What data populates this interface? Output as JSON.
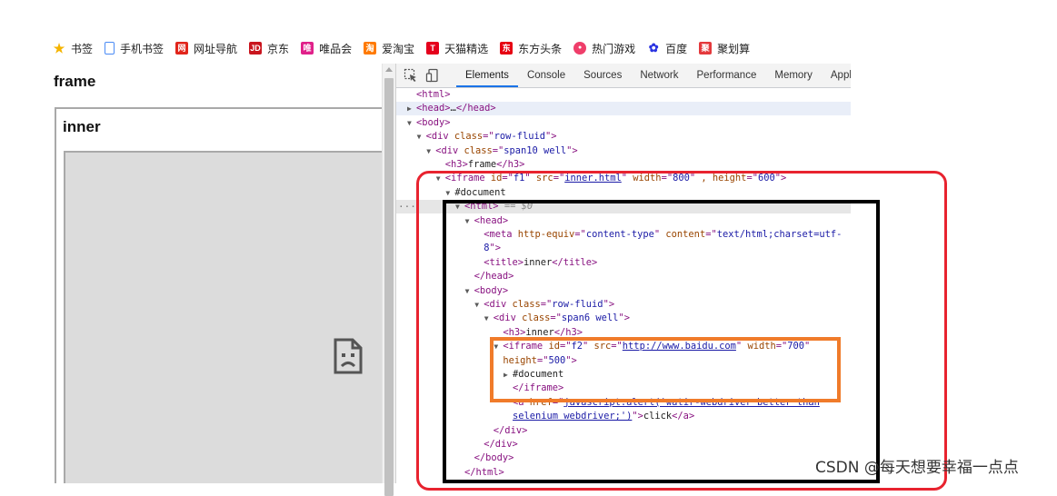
{
  "bookmarks": [
    {
      "label": "书签",
      "icon": "star-icon",
      "color": "#f5b400",
      "glyph": "★"
    },
    {
      "label": "手机书签",
      "icon": "phone-bookmark-icon",
      "color": "#4a8bf5",
      "glyph": ""
    },
    {
      "label": "网址导航",
      "icon": "nav-icon",
      "color": "#e1251b",
      "glyph": "网"
    },
    {
      "label": "京东",
      "icon": "jd-icon",
      "color": "#c9151e",
      "glyph": "JD"
    },
    {
      "label": "唯品会",
      "icon": "vip-icon",
      "color": "#e0218a",
      "glyph": "唯"
    },
    {
      "label": "爱淘宝",
      "icon": "taobao-icon",
      "color": "#ff7a00",
      "glyph": "淘"
    },
    {
      "label": "天猫精选",
      "icon": "tmall-icon",
      "color": "#e5001c",
      "glyph": "T"
    },
    {
      "label": "东方头条",
      "icon": "toutiao-icon",
      "color": "#e60012",
      "glyph": "东"
    },
    {
      "label": "热门游戏",
      "icon": "game-icon",
      "color": "#ef3e6a",
      "glyph": "●"
    },
    {
      "label": "百度",
      "icon": "baidu-icon",
      "color": "#2932e1",
      "glyph": "✿"
    },
    {
      "label": "聚划算",
      "icon": "juhuasuan-icon",
      "color": "#e4393c",
      "glyph": "聚"
    }
  ],
  "page": {
    "frame_heading": "frame",
    "inner_heading": "inner"
  },
  "devtools": {
    "tabs": [
      "Elements",
      "Console",
      "Sources",
      "Network",
      "Performance",
      "Memory",
      "Appl"
    ],
    "active_tab": "Elements",
    "dom_lines": [
      {
        "indent": 0,
        "tri": "",
        "html": "<span class=\"tag\">&lt;html&gt;</span>"
      },
      {
        "indent": 0,
        "tri": "▶",
        "cls": "sel-head",
        "html": "<span class=\"tag\">&lt;head&gt;</span><span class=\"txt\">…</span><span class=\"tag\">&lt;/head&gt;</span>"
      },
      {
        "indent": 0,
        "tri": "▼",
        "html": "<span class=\"tag\">&lt;body&gt;</span>"
      },
      {
        "indent": 1,
        "tri": "▼",
        "html": "<span class=\"tag\">&lt;div </span><span class=\"an\">class</span><span class=\"tag\">=\"</span><span class=\"av\">row-fluid</span><span class=\"tag\">\"&gt;</span>"
      },
      {
        "indent": 2,
        "tri": "▼",
        "html": "<span class=\"tag\">&lt;div </span><span class=\"an\">class</span><span class=\"tag\">=\"</span><span class=\"av\">span10 well</span><span class=\"tag\">\"&gt;</span>"
      },
      {
        "indent": 3,
        "tri": "",
        "html": "<span class=\"tag\">&lt;h3&gt;</span><span class=\"txt\">frame</span><span class=\"tag\">&lt;/h3&gt;</span>"
      },
      {
        "indent": 3,
        "tri": "▼",
        "html": "<span class=\"tag\">&lt;iframe </span><span class=\"an\">id</span><span class=\"tag\">=\"</span><span class=\"av\">f1</span><span class=\"tag\">\" </span><span class=\"an\">src</span><span class=\"tag\">=\"</span><span class=\"av link\">inner.html</span><span class=\"tag\">\" </span><span class=\"an\">width</span><span class=\"tag\">=\"</span><span class=\"av\">800</span><span class=\"tag\">\" </span><span class=\"an\">,</span> <span class=\"an\">height</span><span class=\"tag\">=\"</span><span class=\"av\">600</span><span class=\"tag\">\"&gt;</span>"
      },
      {
        "indent": 4,
        "tri": "▼",
        "html": "<span class=\"txt\">#document</span>"
      },
      {
        "indent": 5,
        "tri": "▼",
        "cls": "current",
        "dots": "···",
        "html": "<span class=\"tag\">&lt;html&gt;</span> <span class=\"muted\">== $0</span>"
      },
      {
        "indent": 6,
        "tri": "▼",
        "html": "<span class=\"tag\">&lt;head&gt;</span>"
      },
      {
        "indent": 7,
        "tri": "",
        "html": "<span class=\"tag\">&lt;meta </span><span class=\"an\">http-equiv</span><span class=\"tag\">=\"</span><span class=\"av\">content-type</span><span class=\"tag\">\" </span><span class=\"an\">content</span><span class=\"tag\">=\"</span><span class=\"av\">text/html;charset=utf-</span>"
      },
      {
        "indent": 7,
        "tri": "",
        "html": "<span class=\"av\">8</span><span class=\"tag\">\"&gt;</span>"
      },
      {
        "indent": 7,
        "tri": "",
        "html": "<span class=\"tag\">&lt;title&gt;</span><span class=\"txt\">inner</span><span class=\"tag\">&lt;/title&gt;</span>"
      },
      {
        "indent": 6,
        "tri": "",
        "html": "<span class=\"tag\">&lt;/head&gt;</span>"
      },
      {
        "indent": 6,
        "tri": "▼",
        "html": "<span class=\"tag\">&lt;body&gt;</span>"
      },
      {
        "indent": 7,
        "tri": "▼",
        "html": "<span class=\"tag\">&lt;div </span><span class=\"an\">class</span><span class=\"tag\">=\"</span><span class=\"av\">row-fluid</span><span class=\"tag\">\"&gt;</span>"
      },
      {
        "indent": 8,
        "tri": "▼",
        "html": "<span class=\"tag\">&lt;div </span><span class=\"an\">class</span><span class=\"tag\">=\"</span><span class=\"av\">span6 well</span><span class=\"tag\">\"&gt;</span>"
      },
      {
        "indent": 9,
        "tri": "",
        "html": "<span class=\"tag\">&lt;h3&gt;</span><span class=\"txt\">inner</span><span class=\"tag\">&lt;/h3&gt;</span>"
      },
      {
        "indent": 9,
        "tri": "▼",
        "html": "<span class=\"tag\">&lt;iframe </span><span class=\"an\">id</span><span class=\"tag\">=\"</span><span class=\"av\">f2</span><span class=\"tag\">\" </span><span class=\"an\">src</span><span class=\"tag\">=\"</span><span class=\"av link\">http://www.baidu.com</span><span class=\"tag\">\" </span><span class=\"an\">width</span><span class=\"tag\">=\"</span><span class=\"av\">700</span><span class=\"tag\">\"</span>"
      },
      {
        "indent": 9,
        "tri": "",
        "html": "<span class=\"an\">height</span><span class=\"tag\">=\"</span><span class=\"av\">500</span><span class=\"tag\">\"&gt;</span>"
      },
      {
        "indent": 10,
        "tri": "▶",
        "html": "<span class=\"txt\">#document</span>"
      },
      {
        "indent": 10,
        "tri": "",
        "html": "<span class=\"tag\">&lt;/iframe&gt;</span>"
      },
      {
        "indent": 10,
        "tri": "",
        "html": "<span class=\"tag\">&lt;a </span><span class=\"an\">href</span><span class=\"tag\">=\"</span><span class=\"av link\">javascript:alert('watir-webdriver better than</span>"
      },
      {
        "indent": 10,
        "tri": "",
        "html": "<span class=\"av link\">selenium webdriver;')</span><span class=\"tag\">\"&gt;</span><span class=\"txt\">click</span><span class=\"tag\">&lt;/a&gt;</span>"
      },
      {
        "indent": 8,
        "tri": "",
        "html": "<span class=\"tag\">&lt;/div&gt;</span>"
      },
      {
        "indent": 7,
        "tri": "",
        "html": "<span class=\"tag\">&lt;/div&gt;</span>"
      },
      {
        "indent": 6,
        "tri": "",
        "html": "<span class=\"tag\">&lt;/body&gt;</span>"
      },
      {
        "indent": 5,
        "tri": "",
        "html": "<span class=\"tag\">&lt;/html&gt;</span>"
      }
    ]
  },
  "overlay_colors": {
    "red": "#e8232f",
    "black": "#000000",
    "orange": "#f07b2a"
  },
  "watermark": "CSDN @每天想要幸福一点点"
}
